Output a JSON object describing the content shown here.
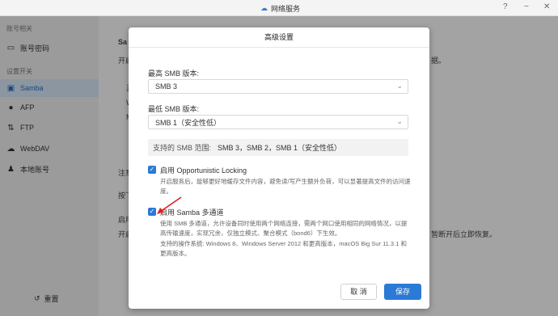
{
  "window": {
    "title": "网络服务"
  },
  "sidebar": {
    "group1": "账号相关",
    "account": "账号密码",
    "group2": "设置开关",
    "items": [
      "Samba",
      "AFP",
      "FTP",
      "WebDAV",
      "本地账号"
    ],
    "reset": "重置"
  },
  "background": {
    "samba_title": "Sa",
    "line1": "开启",
    "line2": "注意",
    "line3": "启用",
    "line4": "开启",
    "right_text1": "据。",
    "right_text2": "暂断开后立即恢复。",
    "misc1": "按下",
    "misc2": "正",
    "misc3": "W",
    "misc4": "M"
  },
  "dialog": {
    "title": "高级设置",
    "max_label": "最高 SMB 版本:",
    "max_value": "SMB 3",
    "min_label": "最低 SMB 版本:",
    "min_value": "SMB 1（安全性低）",
    "support_label": "支持的 SMB 范围:",
    "support_value": "SMB 3，SMB 2，SMB 1（安全性低）",
    "opt1_label": "启用 Opportunistic Locking",
    "opt1_desc": "开启服务后，能够更好地缓存文件内容，避免读/写产生额外负荷，可以显著提高文件的访问速度。",
    "opt2_label": "启用 Samba 多通道",
    "opt2_desc1": "使用 SMB 多通道，允许设备同时使用两个网络连接，需两个网口使用相同的网络情况，以提高传输速度，实现冗余，仅独立模式、聚合模式（bond6）下生效。",
    "opt2_desc2": "支持的操作系统: Windows 8、Windows Server 2012 和更高版本，macOS Big Sur 11.3.1 和更高版本。",
    "cancel": "取 消",
    "save": "保存"
  },
  "colors": {
    "accent": "#2b7ad6",
    "arrow": "#e02020"
  }
}
